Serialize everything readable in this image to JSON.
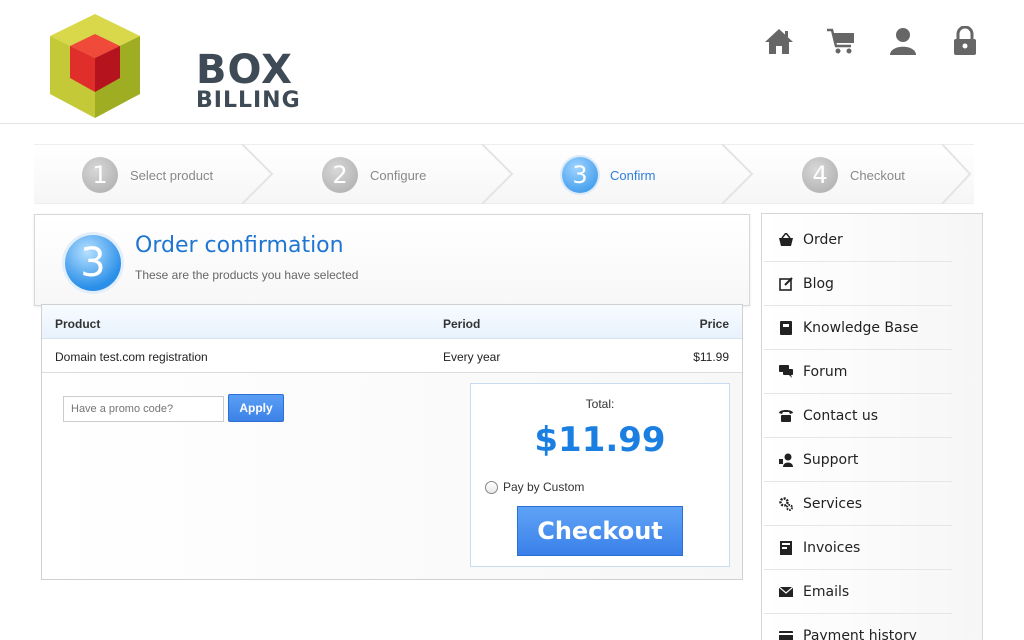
{
  "brand": {
    "line1": "BOX",
    "line2": "BILLING"
  },
  "top_nav": [
    {
      "icon": "home-icon"
    },
    {
      "icon": "cart-icon"
    },
    {
      "icon": "user-icon"
    },
    {
      "icon": "lock-icon"
    }
  ],
  "steps": [
    {
      "num": "1",
      "label": "Select product",
      "active": false
    },
    {
      "num": "2",
      "label": "Configure",
      "active": false
    },
    {
      "num": "3",
      "label": "Confirm",
      "active": true
    },
    {
      "num": "4",
      "label": "Checkout",
      "active": false
    }
  ],
  "confirm": {
    "num": "3",
    "title": "Order confirmation",
    "subtitle": "These are the products you have selected"
  },
  "table": {
    "headers": [
      "Product",
      "Period",
      "Price"
    ],
    "rows": [
      [
        "Domain test.com registration",
        "Every year",
        "$11.99"
      ]
    ]
  },
  "promo": {
    "placeholder": "Have a promo code?",
    "apply_label": "Apply"
  },
  "total": {
    "label": "Total:",
    "value": "$11.99",
    "pay_option": "Pay by Custom",
    "checkout_label": "Checkout"
  },
  "sidebar": {
    "items": [
      {
        "label": "Order",
        "icon": "basket-icon"
      },
      {
        "label": "Blog",
        "icon": "edit-icon"
      },
      {
        "label": "Knowledge Base",
        "icon": "book-icon"
      },
      {
        "label": "Forum",
        "icon": "chat-icon"
      },
      {
        "label": "Contact us",
        "icon": "phone-icon"
      },
      {
        "label": "Support",
        "icon": "support-icon"
      },
      {
        "label": "Services",
        "icon": "gears-icon"
      },
      {
        "label": "Invoices",
        "icon": "invoice-icon"
      },
      {
        "label": "Emails",
        "icon": "mail-icon"
      },
      {
        "label": "Payment history",
        "icon": "payment-icon"
      }
    ]
  },
  "colors": {
    "accent": "#1f76d2",
    "button": "#3c82e8"
  }
}
